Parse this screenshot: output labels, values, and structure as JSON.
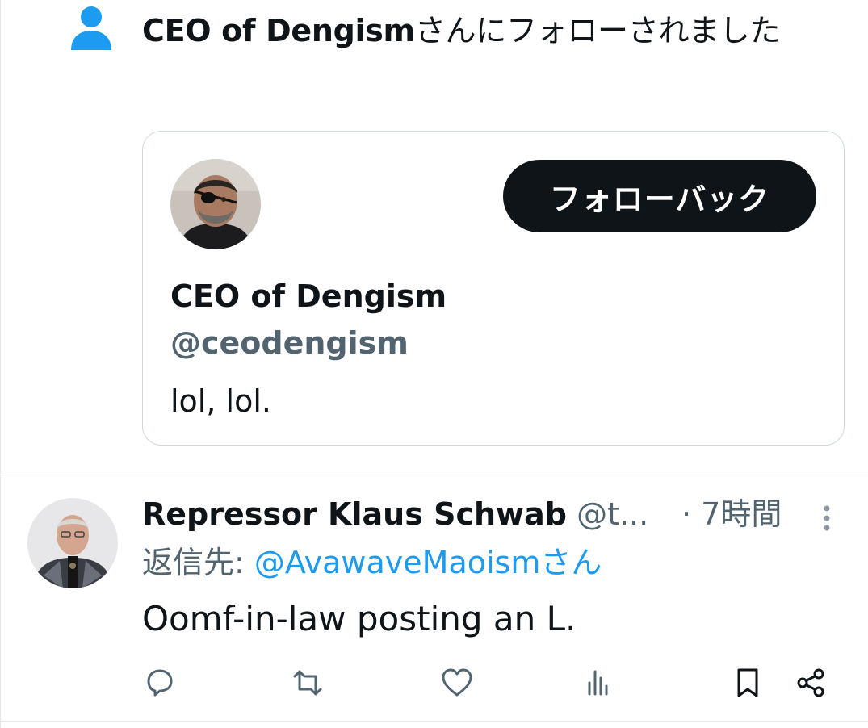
{
  "notification": {
    "icon": "person-icon",
    "follower_name": "CEO of Dengism",
    "message_suffix": "さんにフォローされました"
  },
  "follower_card": {
    "avatar": "avatar-eyepatch",
    "follow_back_label": "フォローバック",
    "display_name": "CEO of Dengism",
    "handle": "@ceodengism",
    "bio": "lol, lol."
  },
  "reply_tweet": {
    "avatar": "avatar-klaus",
    "display_name": "Repressor Klaus Schwab",
    "handle_truncated": "@t...",
    "time": "· 7時間",
    "reply_prefix": "返信先: ",
    "reply_mention": "@AvawaveMaoismさん",
    "text": "Oomf-in-law posting an L.",
    "actions": [
      "reply-icon",
      "retweet-icon",
      "like-icon",
      "views-icon",
      "bookmark-icon",
      "share-icon"
    ]
  },
  "colors": {
    "accent": "#1d9bf0",
    "text": "#0f1419",
    "secondary": "#536471",
    "border": "#cfd9de",
    "button_bg": "#0f1419"
  }
}
